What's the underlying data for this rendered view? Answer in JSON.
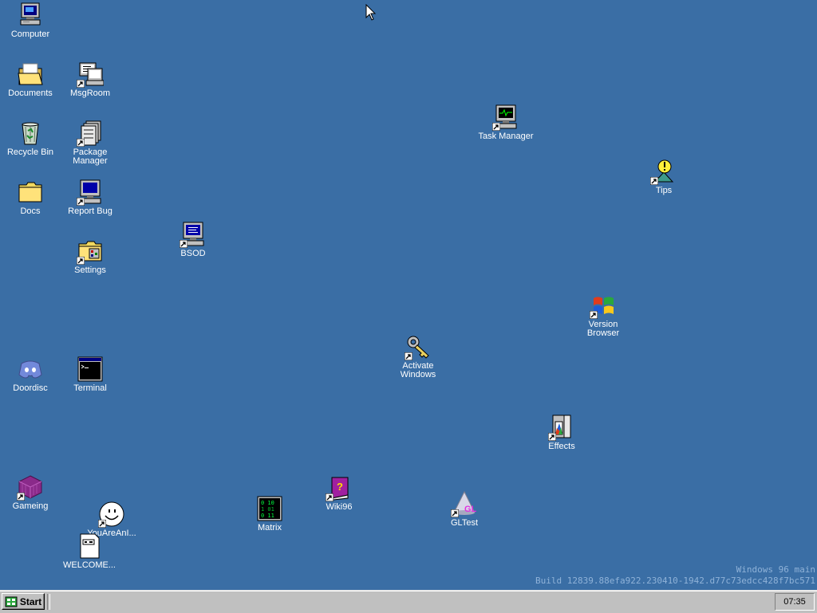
{
  "desktop": {
    "icons": {
      "computer": {
        "label": "Computer",
        "icon": "computer-icon"
      },
      "documents": {
        "label": "Documents",
        "icon": "open-folder-icon"
      },
      "msgroom": {
        "label": "MsgRoom",
        "icon": "chat-computer-icon",
        "shortcut": true
      },
      "recycle_bin": {
        "label": "Recycle Bin",
        "icon": "recycle-bin-icon"
      },
      "package_manager": {
        "label": "Package Manager",
        "icon": "package-manager-icon",
        "shortcut": true
      },
      "docs": {
        "label": "Docs",
        "icon": "folder-icon"
      },
      "report_bug": {
        "label": "Report Bug",
        "icon": "computer-icon",
        "shortcut": true
      },
      "settings": {
        "label": "Settings",
        "icon": "settings-folder-icon",
        "shortcut": true
      },
      "bsod": {
        "label": "BSOD",
        "icon": "bsod-computer-icon",
        "shortcut": true
      },
      "task_manager": {
        "label": "Task Manager",
        "icon": "task-manager-icon",
        "shortcut": true
      },
      "tips": {
        "label": "Tips",
        "icon": "tips-lightbulb-icon",
        "shortcut": true
      },
      "version_browser": {
        "label": "Version Browser",
        "icon": "windows-flag-icon",
        "shortcut": true
      },
      "activate_windows": {
        "label": "Activate Windows",
        "icon": "key-icon",
        "shortcut": true
      },
      "doordisc": {
        "label": "Doordisc",
        "icon": "discord-icon"
      },
      "terminal": {
        "label": "Terminal",
        "icon": "terminal-icon"
      },
      "effects": {
        "label": "Effects",
        "icon": "effects-icon",
        "shortcut": true
      },
      "gameing": {
        "label": "Gameing",
        "icon": "purple-cube-icon",
        "shortcut": true
      },
      "youareanidiot": {
        "label": "YouAreAnI...",
        "icon": "smiley-face-icon",
        "shortcut": true
      },
      "matrix": {
        "label": "Matrix",
        "icon": "matrix-icon"
      },
      "wiki96": {
        "label": "Wiki96",
        "icon": "help-book-icon",
        "shortcut": true
      },
      "gltest": {
        "label": "GLTest",
        "icon": "opengl-cone-icon",
        "shortcut": true
      },
      "welcome": {
        "label": "WELCOME...",
        "icon": "text-document-icon"
      }
    }
  },
  "watermark": {
    "line1": "Windows 96 main",
    "line2": "Build 12839.88efa922.230410-1942.d77c73edcc428f7bc571"
  },
  "taskbar": {
    "start_label": "Start",
    "clock": "07:35"
  },
  "colors": {
    "desktop_background": "#3a6ea5",
    "taskbar": "#c0c0c0",
    "watermark_text": "#8fb2d8"
  }
}
